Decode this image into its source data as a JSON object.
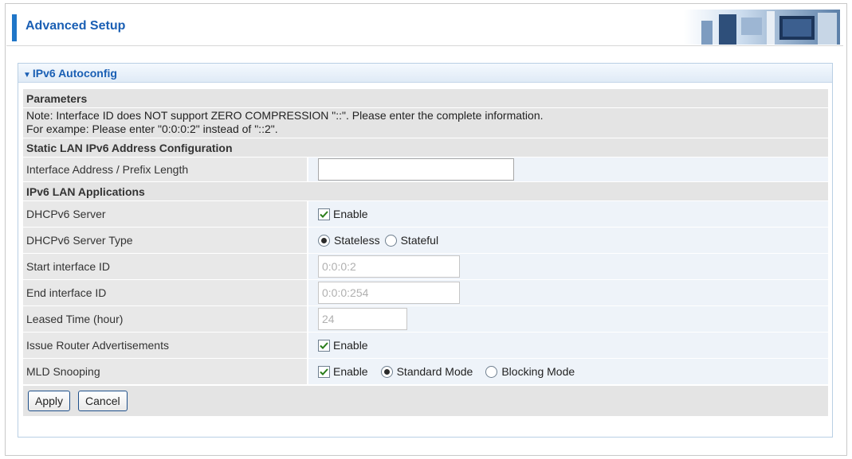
{
  "header": {
    "title": "Advanced Setup"
  },
  "panel": {
    "title": "IPv6 Autoconfig"
  },
  "sections": {
    "parameters": "Parameters",
    "note_line1": "Note: Interface ID does NOT support ZERO COMPRESSION \"::\". Please enter the complete information.",
    "note_line2": "For exampe: Please enter \"0:0:0:2\" instead of \"::2\".",
    "static_lan": "Static LAN IPv6 Address Configuration",
    "lan_apps": "IPv6 LAN Applications"
  },
  "fields": {
    "interface_address": {
      "label": "Interface Address / Prefix Length",
      "value": ""
    },
    "dhcpv6_server": {
      "label": "DHCPv6 Server",
      "checkbox_label": "Enable",
      "checked": true
    },
    "dhcpv6_server_type": {
      "label": "DHCPv6 Server Type",
      "options": [
        "Stateless",
        "Stateful"
      ],
      "selected": "Stateless"
    },
    "start_interface_id": {
      "label": "Start interface ID",
      "value": "0:0:0:2"
    },
    "end_interface_id": {
      "label": "End interface ID",
      "value": "0:0:0:254"
    },
    "leased_time": {
      "label": "Leased Time (hour)",
      "value": "24"
    },
    "issue_router_ads": {
      "label": "Issue Router Advertisements",
      "checkbox_label": "Enable",
      "checked": true
    },
    "mld_snooping": {
      "label": "MLD Snooping",
      "checkbox_label": "Enable",
      "checked": true,
      "options": [
        "Standard Mode",
        "Blocking Mode"
      ],
      "selected": "Standard Mode"
    }
  },
  "buttons": {
    "apply": "Apply",
    "cancel": "Cancel"
  },
  "colors": {
    "accent": "#1a5fb4",
    "header_bar": "#1f76c8"
  }
}
